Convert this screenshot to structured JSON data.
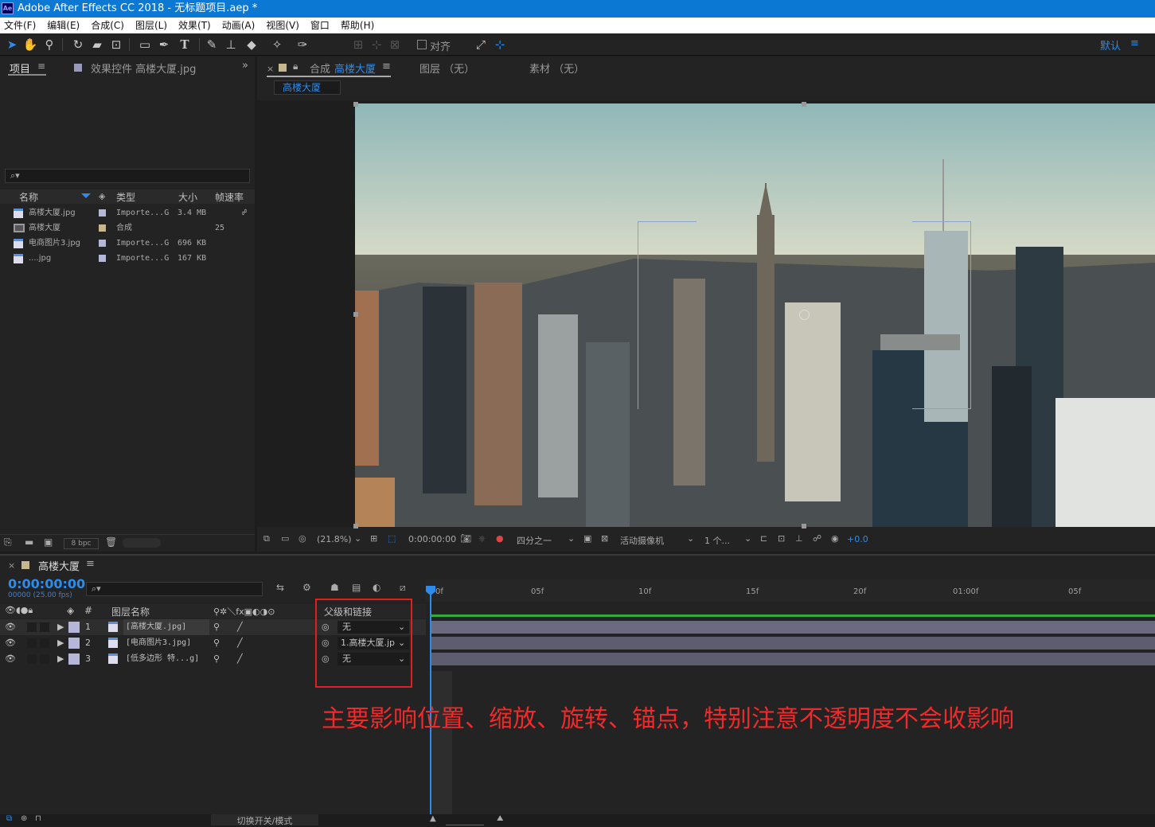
{
  "window": {
    "title": "Adobe After Effects CC 2018 - 无标题项目.aep *",
    "logo": "Ae"
  },
  "menu": [
    "文件(F)",
    "编辑(E)",
    "合成(C)",
    "图层(L)",
    "效果(T)",
    "动画(A)",
    "视图(V)",
    "窗口",
    "帮助(H)"
  ],
  "toolbar": {
    "snap_label": "对齐",
    "workspace": "默认"
  },
  "project": {
    "tab_project": "项目",
    "tab_effects": "效果控件 高楼大厦.jpg",
    "search_icon": "⌕▾",
    "columns": {
      "name": "名称",
      "type": "类型",
      "size": "大小",
      "fps": "帧速率"
    },
    "items": [
      {
        "name": "高楼大厦.jpg",
        "type": "Importe...G",
        "size": "3.4 MB",
        "fps": "",
        "color": "#b6b6d8"
      },
      {
        "name": "高楼大厦",
        "type": "合成",
        "size": "",
        "fps": "25",
        "color": "#c7b78e"
      },
      {
        "name": "电商图片3.jpg",
        "type": "Importe...G",
        "size": "696 KB",
        "fps": "",
        "color": "#b6b6d8"
      },
      {
        "name": "....jpg",
        "type": "Importe...G",
        "size": "167 KB",
        "fps": "",
        "color": "#b6b6d8"
      }
    ],
    "bpc": "8 bpc"
  },
  "comp": {
    "tab_comp_prefix": "合成",
    "tab_comp_name": "高楼大厦",
    "tab_layer": "图层 （无）",
    "tab_footage": "素材 （无）",
    "breadcrumb": "高楼大厦",
    "zoom": "(21.8%)",
    "timecode": "0:00:00:00",
    "resolution": "四分之一",
    "camera": "活动摄像机",
    "views": "1 个...",
    "exposure": "+0.0"
  },
  "timeline": {
    "comp_name": "高楼大厦",
    "timecode": "0:00:00:00",
    "frame_info": "00000 (25.00 fps)",
    "col_layer_name": "图层名称",
    "col_num": "#",
    "col_parent": "父级和链接",
    "ruler": [
      "0f",
      "05f",
      "10f",
      "15f",
      "20f",
      "01:00f",
      "05f"
    ],
    "layers": [
      {
        "num": "1",
        "name": "[高楼大厦.jpg]",
        "parent": "无"
      },
      {
        "num": "2",
        "name": "[电商图片3.jpg]",
        "parent": "1.高楼大厦.jp"
      },
      {
        "num": "3",
        "name": "[低多边形 特...g]",
        "parent": "无"
      }
    ],
    "annotation": "主要影响位置、缩放、旋转、锚点，特别注意不透明度不会收影响",
    "bottom_label": "切换开关/模式"
  }
}
